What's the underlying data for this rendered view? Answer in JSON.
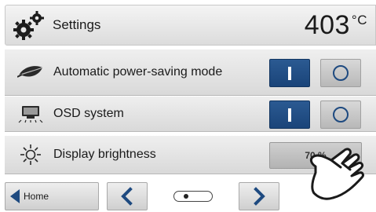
{
  "header": {
    "title": "Settings",
    "temperature": "403",
    "unit": "°C",
    "icon": "gears-icon"
  },
  "settings": [
    {
      "label": "Automatic power-saving mode",
      "icon": "leaf-icon",
      "on_active": true,
      "off_active": false
    },
    {
      "label": "OSD system",
      "icon": "monitor-icon",
      "on_active": true,
      "off_active": false
    },
    {
      "label": "Display brightness",
      "icon": "sun-icon",
      "value": "70 %"
    }
  ],
  "footer": {
    "home_label": "Home",
    "prev_icon": "chevron-left-icon",
    "next_icon": "chevron-right-icon",
    "page_indicator": "page-dots"
  },
  "colors": {
    "accent": "#1e4a80",
    "on_button": "#1a4479",
    "off_button": "#c4c4c4",
    "row_background": "#e3e3e3"
  },
  "overlay": {
    "icon": "pointing-hand-icon"
  }
}
